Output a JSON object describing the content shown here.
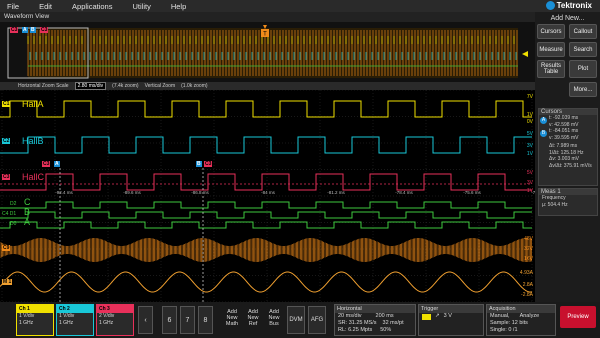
{
  "menu": [
    "File",
    "Edit",
    "Applications",
    "Utility",
    "Help"
  ],
  "brand": "Tektronix",
  "add_new": "Add New...",
  "right_buttons": {
    "cursors": "Cursors",
    "callout": "Callout",
    "measure": "Measure",
    "search": "Search",
    "results_table": "Results Table",
    "plot": "Plot",
    "more": "More..."
  },
  "cursors_panel": {
    "title": "Cursors",
    "a_t": "t: -92.039 ms",
    "a_v": "v: 42.598 mV",
    "b_t": "t: -84.051 ms",
    "b_v": "v: 39.595 mV",
    "dt": "Δt: 7.989 ms",
    "inv_dt": "1/Δt: 125.18 Hz",
    "dv": "Δv: 3.003 mV",
    "dvdt": "Δv/Δt: 375.91 mV/s"
  },
  "meas_panel": {
    "title": "Meas 1",
    "label": "Frequency",
    "value": "µ: 504.4 Hz"
  },
  "waveform_view": "Waveform View",
  "zoom": {
    "h_label": "Horizontal Zoom Scale",
    "h_value": "2.80 ms/div",
    "pos": "(7.4k zoom)",
    "v_label": "Vertical Zoom",
    "v_value": "(1.0k zoom)"
  },
  "channels": {
    "c1": "HallA",
    "c2": "HallB",
    "c3": "HallC"
  },
  "digital": {
    "d2": "C",
    "d1": "B",
    "d0": "A"
  },
  "digital_tags": {
    "d2": "D2",
    "d1": "C4 D1",
    "d0": "D0"
  },
  "tags": {
    "c1": "C1",
    "c2": "C2",
    "c3": "C3",
    "c9": "C9",
    "m1": "M 1"
  },
  "time_axis": [
    "-92.4 ms",
    "-89.6 ms",
    "-86.8 ms",
    "-84 ms",
    "-81.2 ms",
    "-78.4 ms",
    "-75.6 ms",
    "-72.8 ms"
  ],
  "volts_ch1": [
    "7V",
    "1V",
    "0V"
  ],
  "volts_ch2": [
    "5V",
    "3V",
    "1V"
  ],
  "volts_ch3": [
    "5V",
    "3V",
    "1V"
  ],
  "volts_c9": [
    "48V",
    "32V",
    "16V"
  ],
  "volts_m1": [
    "4.93A",
    "2.8A",
    "-2.8A"
  ],
  "bottom": {
    "ch1": {
      "h": "Ch 1",
      "scale": "1 V/div",
      "bw": "1 GHz"
    },
    "ch2": {
      "h": "Ch 2",
      "scale": "1 V/div",
      "bw": "1 GHz"
    },
    "ch3": {
      "h": "Ch 3",
      "scale": "2 V/div",
      "bw": "1 GHz"
    },
    "nums": [
      "6",
      "7",
      "8"
    ],
    "add_math": "Add New Math",
    "add_ref": "Add New Ref",
    "add_bus": "Add New Bus",
    "dvm": "DVM",
    "afg": "AFG",
    "horizontal": {
      "h": "Horizontal",
      "a": "20 ms/div",
      "b": "200 ms",
      "c": "SR: 31.25 MS/s",
      "d": "32 ms/pt",
      "e": "RL: 6.25 Mpts",
      "f": "50%"
    },
    "trigger": {
      "h": "Trigger",
      "a": "3 V"
    },
    "acquisition": {
      "h": "Acquisition",
      "a": "Manual,",
      "b": "Analyze",
      "c": "Sample: 12 bits",
      "d": "Single: 0 /1"
    },
    "preview": "Preview"
  },
  "colors": {
    "ch1": "#f0e000",
    "ch2": "#19c8d8",
    "ch3": "#e8305a",
    "digital": "#3ec93e",
    "c9": "#f08a1a",
    "m1": "#f0a030",
    "bg": "#000000"
  }
}
